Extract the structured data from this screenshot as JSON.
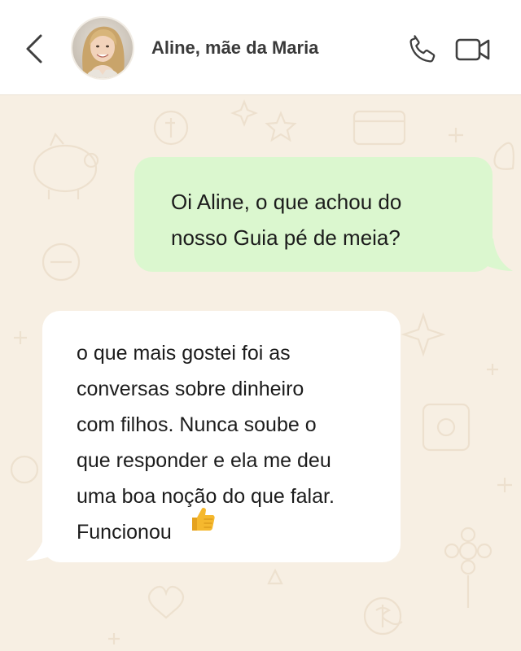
{
  "header": {
    "contact_name": "Aline, mãe da Maria",
    "icons": {
      "back": "chevron-left-icon",
      "avatar": "avatar-photo",
      "call": "phone-icon",
      "video": "video-camera-icon"
    }
  },
  "messages": [
    {
      "direction": "outgoing",
      "text": "Oi Aline, o que achou do\nnosso Guia pé de meia?"
    },
    {
      "direction": "incoming",
      "text": "o que mais gostei foi as\nconversas sobre dinheiro\ncom filhos. Nunca soube o\nque responder e ela me deu\numa boa noção do que falar.\nFuncionou",
      "emoji": "thumbs-up-icon"
    }
  ],
  "colors": {
    "chat_background": "#f7efe3",
    "outgoing_bubble": "#dbf7cf",
    "incoming_bubble": "#ffffff",
    "header_background": "#ffffff",
    "icon_color": "#3f3f3f",
    "emoji_yellow": "#f5b82e"
  }
}
